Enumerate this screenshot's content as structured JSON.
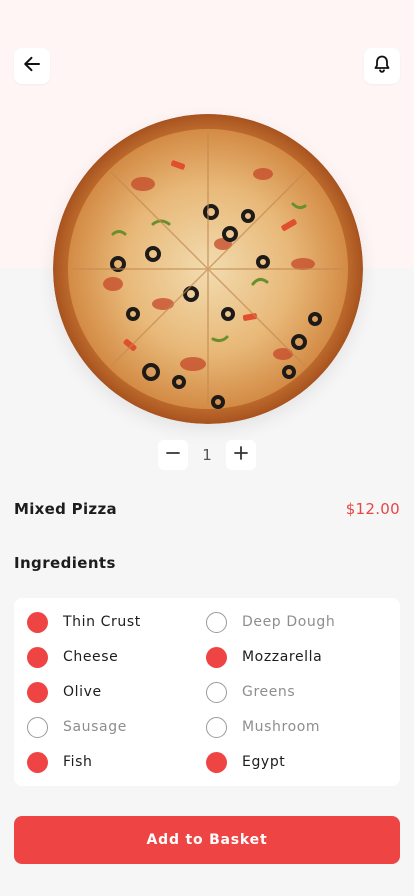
{
  "colors": {
    "accent": "#ef4444",
    "price": "#e84545",
    "header_tint": "#fff5f5",
    "background": "#f6f6f6"
  },
  "header": {
    "back_icon": "arrow-left-icon",
    "notification_icon": "bell-icon"
  },
  "product": {
    "image": "pizza-photo",
    "name": "Mixed Pizza",
    "price": "$12.00",
    "quantity": "1"
  },
  "quantity": {
    "decrement_icon": "minus-icon",
    "increment_icon": "plus-icon"
  },
  "ingredients": {
    "title": "Ingredients",
    "items": [
      {
        "label": "Thin Crust",
        "selected": true
      },
      {
        "label": "Deep Dough",
        "selected": false
      },
      {
        "label": "Cheese",
        "selected": true
      },
      {
        "label": "Mozzarella",
        "selected": true
      },
      {
        "label": "Olive",
        "selected": true
      },
      {
        "label": "Greens",
        "selected": false
      },
      {
        "label": "Sausage",
        "selected": false
      },
      {
        "label": "Mushroom",
        "selected": false
      },
      {
        "label": "Fish",
        "selected": true
      },
      {
        "label": "Egypt",
        "selected": true
      }
    ]
  },
  "cta": {
    "label": "Add to Basket"
  }
}
